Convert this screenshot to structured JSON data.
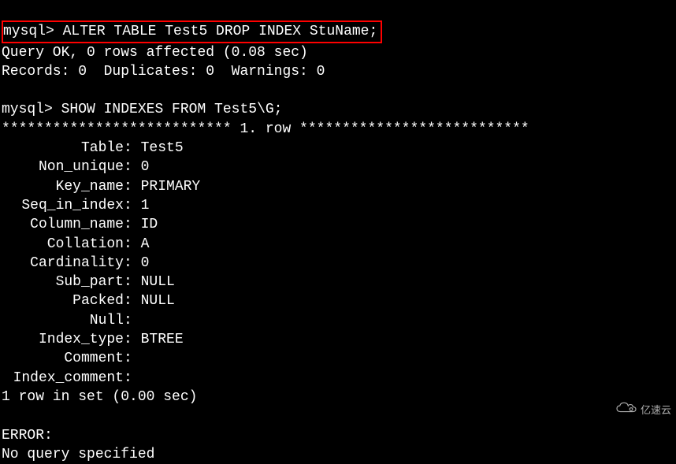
{
  "prompt": "mysql>",
  "command1": "ALTER TABLE Test5 DROP INDEX StuName;",
  "response1_line1": "Query OK, 0 rows affected (0.08 sec)",
  "response1_line2": "Records: 0  Duplicates: 0  Warnings: 0",
  "command2": "SHOW INDEXES FROM Test5\\G;",
  "row_header": "*************************** 1. row ***************************",
  "index_fields": [
    {
      "label": "Table",
      "value": "Test5"
    },
    {
      "label": "Non_unique",
      "value": "0"
    },
    {
      "label": "Key_name",
      "value": "PRIMARY"
    },
    {
      "label": "Seq_in_index",
      "value": "1"
    },
    {
      "label": "Column_name",
      "value": "ID"
    },
    {
      "label": "Collation",
      "value": "A"
    },
    {
      "label": "Cardinality",
      "value": "0"
    },
    {
      "label": "Sub_part",
      "value": "NULL"
    },
    {
      "label": "Packed",
      "value": "NULL"
    },
    {
      "label": "Null",
      "value": ""
    },
    {
      "label": "Index_type",
      "value": "BTREE"
    },
    {
      "label": "Comment",
      "value": ""
    },
    {
      "label": "Index_comment",
      "value": ""
    }
  ],
  "result_footer": "1 row in set (0.00 sec)",
  "error_label": "ERROR:",
  "error_message": "No query specified",
  "watermark_text": "亿速云"
}
